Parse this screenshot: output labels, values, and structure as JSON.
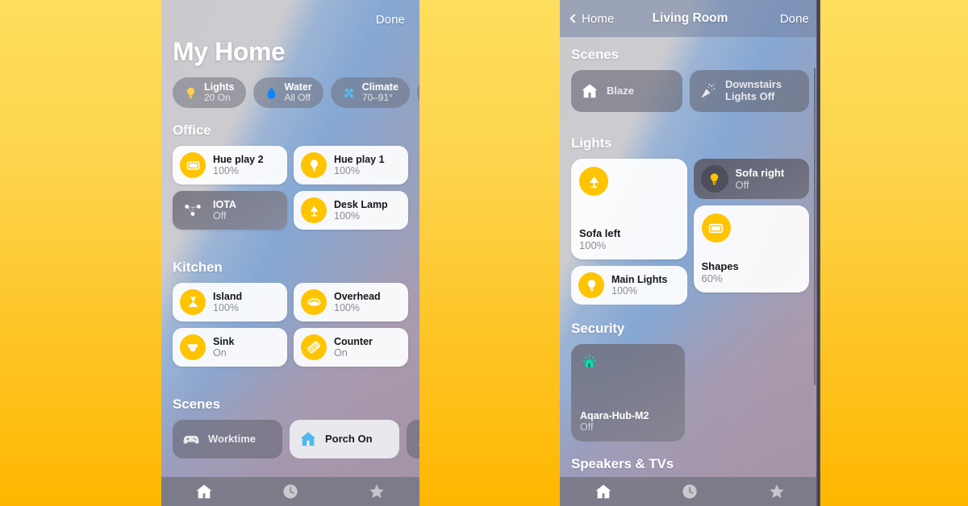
{
  "background": {
    "top_color": "#FEDE5E",
    "bottom_color": "#FFB700"
  },
  "accent": {
    "yellow": "#FFC400",
    "blue": "#3FA0F0",
    "teal": "#55E0C0",
    "sky": "#5AC8F5"
  },
  "left_phone": {
    "nav": {
      "done_label": "Done"
    },
    "title": "My Home",
    "status_pills": [
      {
        "icon": "lightbulb-icon",
        "title": "Lights",
        "subtitle": "20 On",
        "color": "#FFD24A"
      },
      {
        "icon": "water-drop-icon",
        "title": "Water",
        "subtitle": "All Off",
        "color": "#0A84FF"
      },
      {
        "icon": "climate-fan-icon",
        "title": "Climate",
        "subtitle": "70–91°",
        "color": "#4FC3F7"
      },
      {
        "icon": "lock-icon",
        "title": "",
        "subtitle": "",
        "color": "#5AE8C8"
      }
    ],
    "sections": [
      {
        "title": "Office",
        "tiles": [
          {
            "name": "Hue play 2",
            "state": "100%",
            "icon": "light-strip-icon",
            "on": true
          },
          {
            "name": "Hue play 1",
            "state": "100%",
            "icon": "bulb-icon",
            "on": true
          },
          {
            "name": "IOTA",
            "state": "Off",
            "icon": "sensor-network-icon",
            "on": false
          },
          {
            "name": "Desk Lamp",
            "state": "100%",
            "icon": "desk-lamp-icon",
            "on": true
          }
        ]
      },
      {
        "title": "Kitchen",
        "tiles": [
          {
            "name": "Island",
            "state": "100%",
            "icon": "pendant-light-icon",
            "on": true
          },
          {
            "name": "Overhead",
            "state": "100%",
            "icon": "ceiling-light-icon",
            "on": true
          },
          {
            "name": "Sink",
            "state": "On",
            "icon": "recessed-light-icon",
            "on": true
          },
          {
            "name": "Counter",
            "state": "On",
            "icon": "light-strip-diagonal-icon",
            "on": true
          }
        ]
      }
    ],
    "scenes_title": "Scenes",
    "scenes": [
      {
        "label": "Worktime",
        "icon": "gamepad-icon",
        "style": "dark"
      },
      {
        "label": "Porch On",
        "icon": "house-icon",
        "style": "light"
      },
      {
        "label": "",
        "icon": "party-popper-icon",
        "style": "dark"
      }
    ],
    "tabs": [
      {
        "icon": "home-icon",
        "active": true
      },
      {
        "icon": "clock-icon",
        "active": false
      },
      {
        "icon": "star-icon",
        "active": false
      }
    ]
  },
  "right_phone": {
    "nav": {
      "back_label": "Home",
      "title": "Living Room",
      "done_label": "Done"
    },
    "scenes_title": "Scenes",
    "scenes": [
      {
        "label": "Blaze",
        "icon": "house-icon",
        "style": "dark"
      },
      {
        "label": "Downstairs Lights Off",
        "icon": "party-popper-icon",
        "style": "dark"
      },
      {
        "label": "",
        "icon": "house-icon",
        "style": "dark"
      }
    ],
    "lights_title": "Lights",
    "lights": {
      "sofa_left": {
        "name": "Sofa left",
        "state": "100%",
        "icon": "desk-lamp-icon",
        "on": true
      },
      "sofa_right": {
        "name": "Sofa right",
        "state": "Off",
        "icon": "bulb-icon",
        "on": false
      },
      "main_lights": {
        "name": "Main Lights",
        "state": "100%",
        "icon": "bulb-icon",
        "on": true
      },
      "shapes": {
        "name": "Shapes",
        "state": "60%",
        "icon": "light-panel-icon",
        "on": true
      }
    },
    "security_title": "Security",
    "security": [
      {
        "name": "Aqara-Hub-M2",
        "state": "Off",
        "icon": "alarm-siren-icon",
        "on": false
      }
    ],
    "speakers_title": "Speakers & TVs",
    "tabs": [
      {
        "icon": "home-icon",
        "active": true
      },
      {
        "icon": "clock-icon",
        "active": false
      },
      {
        "icon": "star-icon",
        "active": false
      }
    ]
  }
}
